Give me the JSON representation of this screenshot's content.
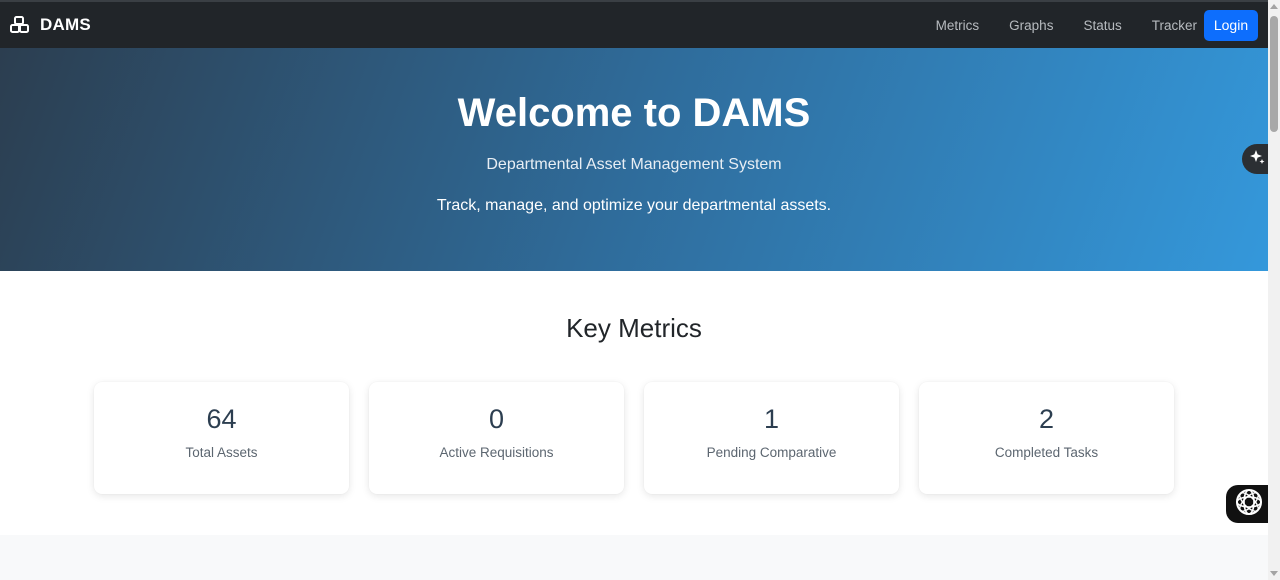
{
  "navbar": {
    "brand": "DAMS",
    "brand_icon": "cubes-icon",
    "links": [
      "Metrics",
      "Graphs",
      "Status",
      "Tracker"
    ],
    "login_label": "Login"
  },
  "hero": {
    "title": "Welcome to DAMS",
    "subtitle": "Departmental Asset Management System",
    "tagline": "Track, manage, and optimize your departmental assets."
  },
  "metrics": {
    "title": "Key Metrics",
    "cards": [
      {
        "value": "64",
        "label": "Total Assets"
      },
      {
        "value": "0",
        "label": "Active Requisitions"
      },
      {
        "value": "1",
        "label": "Pending Comparative"
      },
      {
        "value": "2",
        "label": "Completed Tasks"
      }
    ]
  },
  "widgets": {
    "sparkle_icon": "sparkle-icon",
    "chat_icon": "chat-assistant-icon"
  },
  "colors": {
    "navbar_bg": "#212529",
    "primary": "#0d6efd",
    "hero_gradient_start": "#2c3e50",
    "hero_gradient_end": "#3498db",
    "metric_value": "#2c3e50"
  }
}
